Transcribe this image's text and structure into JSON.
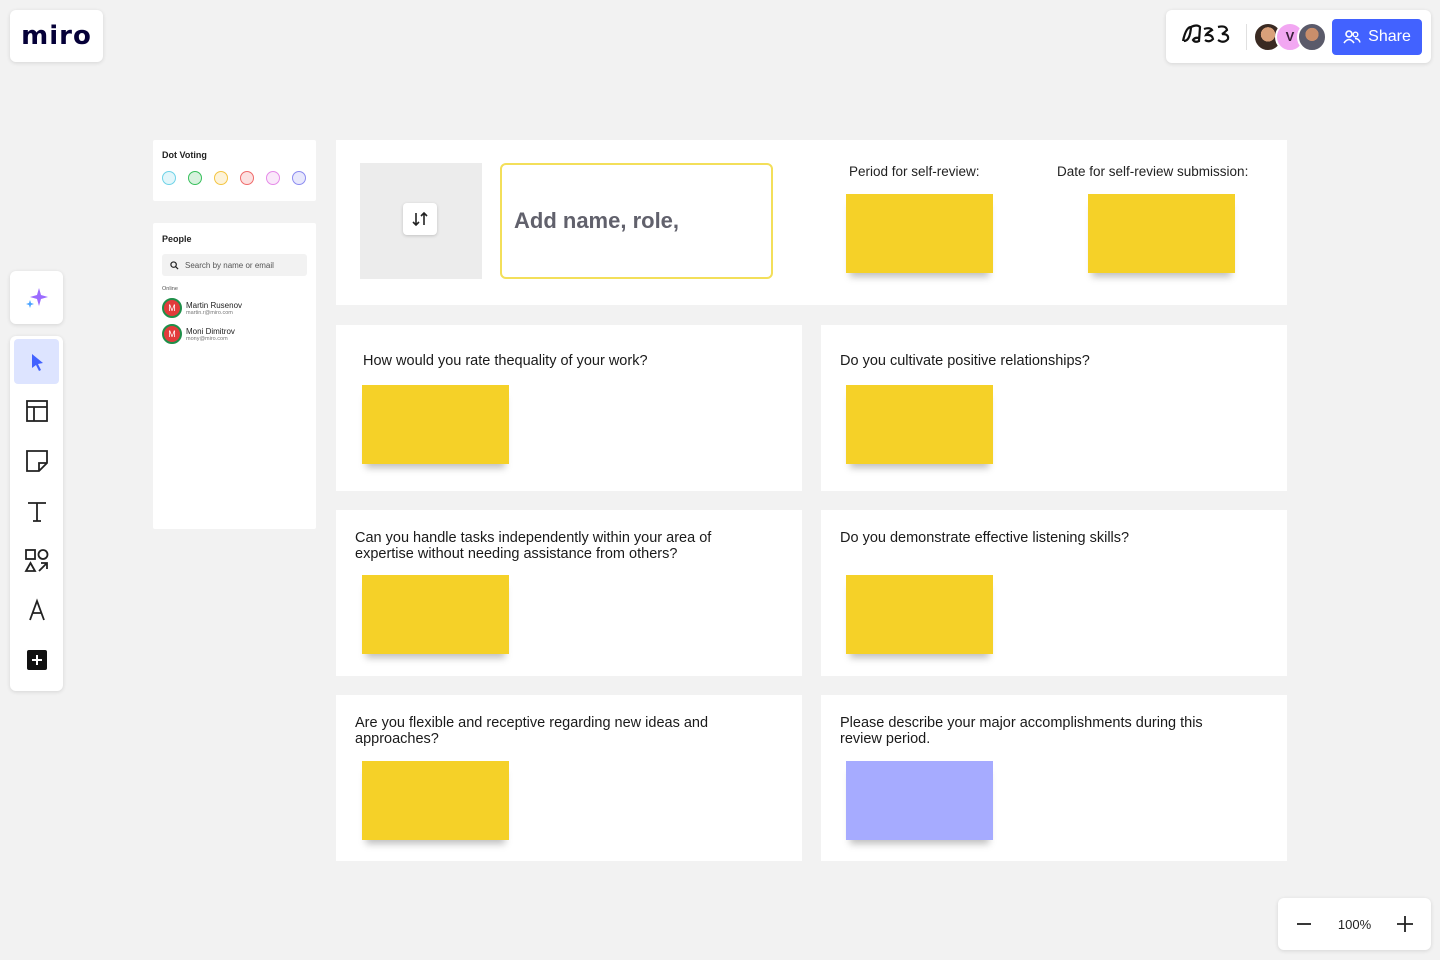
{
  "app": {
    "logo": "miro",
    "board_logo": "ꟿↄ3"
  },
  "collaborators": {
    "avatars": [
      {
        "initial": ""
      },
      {
        "initial": "V"
      },
      {
        "initial": ""
      }
    ],
    "share_label": "Share"
  },
  "dot_voting": {
    "title": "Dot Voting",
    "colors": [
      "#6fd3e8",
      "#38c05c",
      "#f4c542",
      "#ef6b6b",
      "#e58ae8",
      "#8c8cf0"
    ]
  },
  "people": {
    "title": "People",
    "search_placeholder": "Search by name or email",
    "section": "Online",
    "members": [
      {
        "initial": "M",
        "name": "Martin Rusenov",
        "email": "martin.r@miro.com"
      },
      {
        "initial": "M",
        "name": "Moni Dimitrov",
        "email": "mony@miro.com"
      }
    ]
  },
  "board": {
    "name_placeholder": "Add name, role,",
    "period_label": "Period for self-review:",
    "date_label": "Date for self-review submission:",
    "questions": [
      "How would you rate thequality of your work?",
      "Do you cultivate positive relationships?",
      "Can you handle tasks independently within your area of expertise without needing assistance from others?",
      "Do you demonstrate effective listening skills?",
      "Are you flexible and receptive regarding new ideas and approaches?",
      "Please describe your major accomplishments during this review period."
    ],
    "sticky_colors": {
      "yellow": "#f5d128",
      "blue": "#a6abff"
    }
  },
  "zoom": {
    "level": "100%"
  }
}
